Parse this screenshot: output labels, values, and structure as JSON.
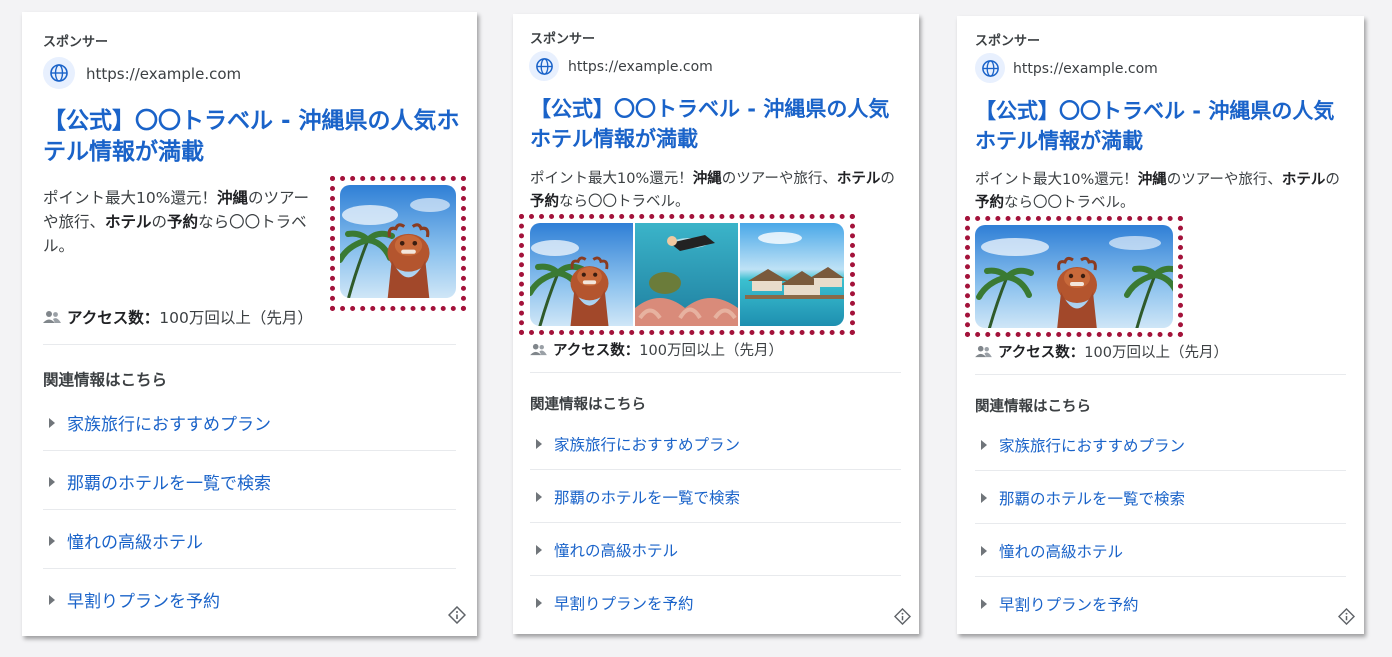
{
  "ads": [
    {
      "sponsored_label": "スポンサー",
      "url": "https://example.com",
      "title": "【公式】〇〇トラベル - 沖縄県の人気ホテル情報が満載",
      "desc_parts": [
        "ポイント最大10%還元！",
        "沖縄",
        "のツアーや旅行、",
        "ホテル",
        "の",
        "予約",
        "なら〇〇トラベル。"
      ],
      "access_label": "アクセス数：",
      "access_value": "100万回以上（先月）",
      "related_heading": "関連情報はこちら",
      "links": [
        "家族旅行におすすめプラン",
        "那覇のホテルを一覧で検索",
        "憧れの高級ホテル",
        "早割りプランを予約"
      ],
      "image_names": [
        "shisa-image"
      ]
    },
    {
      "sponsored_label": "スポンサー",
      "url": "https://example.com",
      "title": "【公式】〇〇トラベル - 沖縄県の人気ホテル情報が満載",
      "desc_parts": [
        "ポイント最大10%還元！",
        "沖縄",
        "のツアーや旅行、",
        "ホテル",
        "の",
        "予約",
        "なら〇〇トラベル。"
      ],
      "access_label": "アクセス数：",
      "access_value": "100万回以上（先月）",
      "related_heading": "関連情報はこちら",
      "links": [
        "家族旅行におすすめプラン",
        "那覇のホテルを一覧で検索",
        "憧れの高級ホテル",
        "早割りプランを予約"
      ],
      "image_names": [
        "shisa-image",
        "snorkel-image",
        "water-villa-image"
      ]
    },
    {
      "sponsored_label": "スポンサー",
      "url": "https://example.com",
      "title": "【公式】〇〇トラベル - 沖縄県の人気ホテル情報が満載",
      "desc_parts": [
        "ポイント最大10%還元！",
        "沖縄",
        "のツアーや旅行、",
        "ホテル",
        "の",
        "予約",
        "なら〇〇トラベル。"
      ],
      "access_label": "アクセス数：",
      "access_value": "100万回以上（先月）",
      "related_heading": "関連情報はこちら",
      "links": [
        "家族旅行におすすめプラン",
        "那覇のホテルを一覧で検索",
        "憧れの高級ホテル",
        "早割りプランを予約"
      ],
      "image_names": [
        "shisa-image-wide"
      ]
    }
  ],
  "icons": {
    "globe": "globe-icon",
    "people": "people-icon",
    "info": "ad-info-icon",
    "chevron": "triangle-right-icon"
  },
  "colors": {
    "link_blue": "#1a63c9",
    "highlight_dash": "#a3123a",
    "globe_bg": "#e8f0fe"
  }
}
